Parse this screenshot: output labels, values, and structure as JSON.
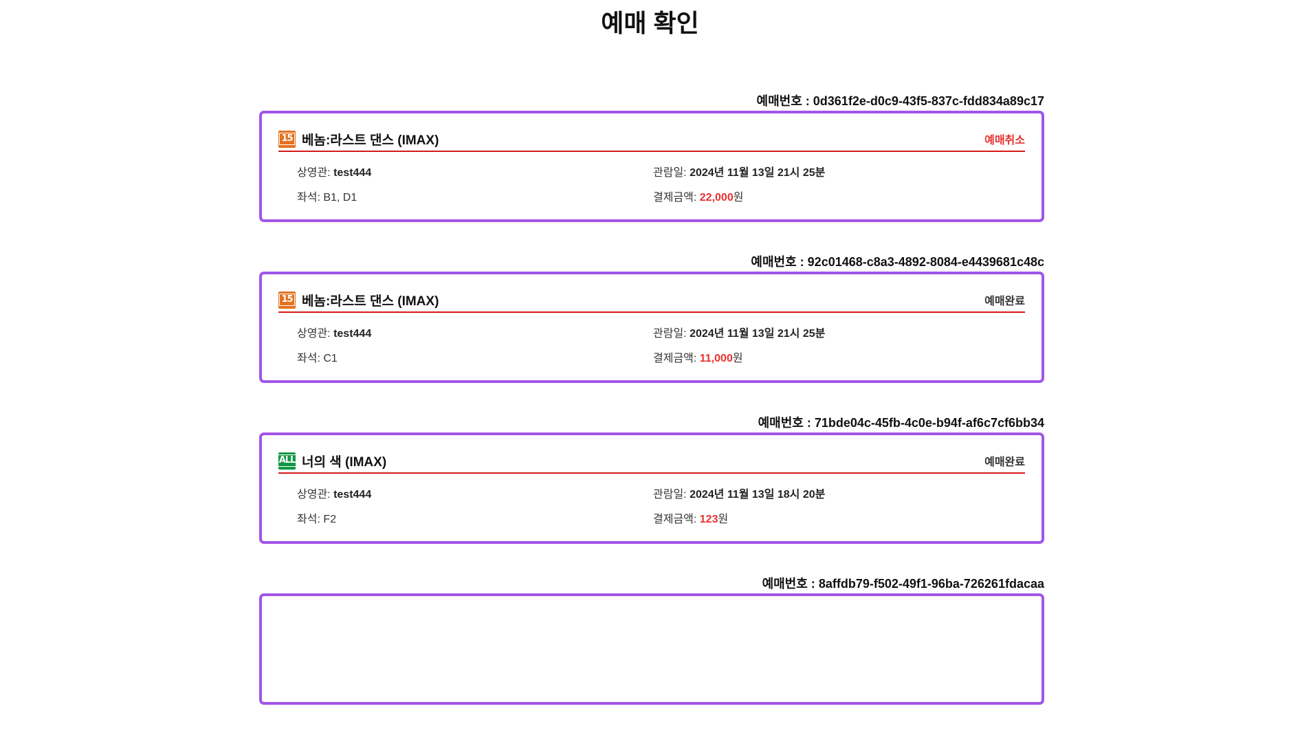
{
  "page": {
    "title": "예매 확인"
  },
  "labels": {
    "booking_number_prefix": "예매번호 : ",
    "theater": "상영관: ",
    "seats": "좌석: ",
    "date": "관람일: ",
    "payment": "결제금액: ",
    "currency_suffix": "원"
  },
  "colors": {
    "card_border": "#a155e9",
    "divider": "#d41818",
    "price": "#e8312f",
    "cancel": "#e8312f",
    "rating_15": "#e47221",
    "rating_all": "#119744"
  },
  "bookings": [
    {
      "booking_number": "0d361f2e-d0c9-43f5-837c-fdd834a89c17",
      "rating": "15",
      "rating_icon": "age-15-rating-icon",
      "rating_color": "#e47221",
      "movie_title": "베놈:라스트 댄스 (IMAX)",
      "status": "예매취소",
      "status_color": "#e8312f",
      "status_interactable": true,
      "theater": "test444",
      "seats": "B1, D1",
      "date": "2024년 11월 13일 21시 25분",
      "price": "22,000"
    },
    {
      "booking_number": "92c01468-c8a3-4892-8084-e4439681c48c",
      "rating": "15",
      "rating_icon": "age-15-rating-icon",
      "rating_color": "#e47221",
      "movie_title": "베놈:라스트 댄스 (IMAX)",
      "status": "예매완료",
      "status_color": "#333333",
      "status_interactable": false,
      "theater": "test444",
      "seats": "C1",
      "date": "2024년 11월 13일 21시 25분",
      "price": "11,000"
    },
    {
      "booking_number": "71bde04c-45fb-4c0e-b94f-af6c7cf6bb34",
      "rating": "ALL",
      "rating_icon": "all-ages-rating-icon",
      "rating_color": "#119744",
      "movie_title": "너의 색 (IMAX)",
      "status": "예매완료",
      "status_color": "#333333",
      "status_interactable": false,
      "theater": "test444",
      "seats": "F2",
      "date": "2024년 11월 13일 18시 20분",
      "price": "123"
    },
    {
      "booking_number": "8affdb79-f502-49f1-96ba-726261fdacaa"
    }
  ]
}
